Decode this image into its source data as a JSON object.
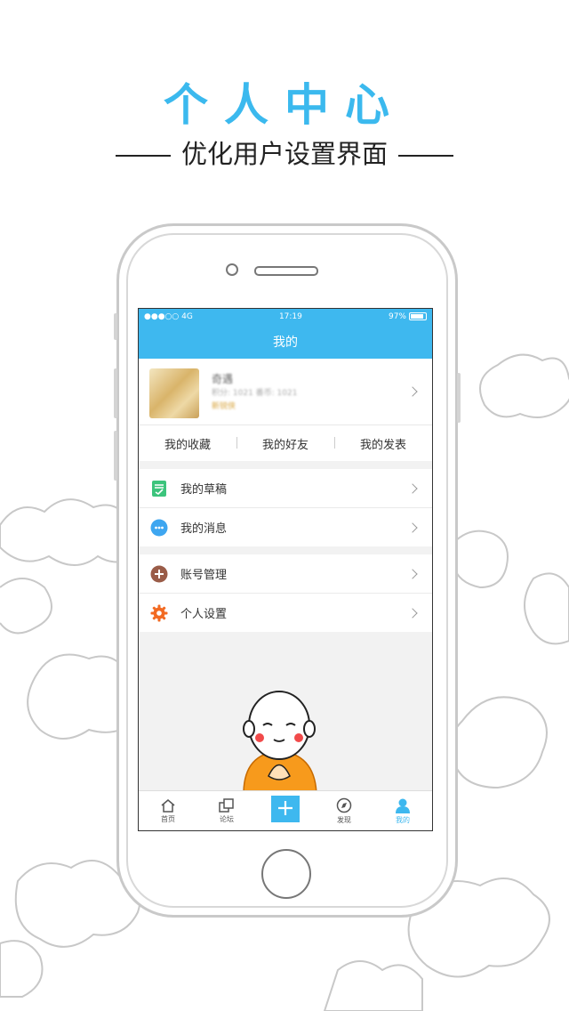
{
  "headline": "个人中心",
  "subline": "优化用户设置界面",
  "colors": {
    "accent": "#3eb8ef",
    "headline": "#3bb9ee"
  },
  "status_bar": {
    "signal": "●●●○○",
    "network": "4G",
    "time": "17:19",
    "battery": "97%"
  },
  "nav": {
    "title": "我的"
  },
  "profile": {
    "name": "奇遇",
    "stats": "积分: 1021    番币: 1021",
    "level": "新锐侠"
  },
  "quick_links": [
    "我的收藏",
    "我的好友",
    "我的发表"
  ],
  "menu_group_1": [
    {
      "label": "我的草稿",
      "icon": "draft-icon"
    },
    {
      "label": "我的消息",
      "icon": "message-icon"
    }
  ],
  "menu_group_2": [
    {
      "label": "账号管理",
      "icon": "account-icon"
    },
    {
      "label": "个人设置",
      "icon": "settings-icon"
    }
  ],
  "tabs": [
    {
      "label": "首页",
      "icon": "home-icon"
    },
    {
      "label": "论坛",
      "icon": "forum-icon"
    },
    {
      "label": "",
      "icon": "plus-icon"
    },
    {
      "label": "发现",
      "icon": "compass-icon"
    },
    {
      "label": "我的",
      "icon": "user-icon",
      "active": true
    }
  ]
}
